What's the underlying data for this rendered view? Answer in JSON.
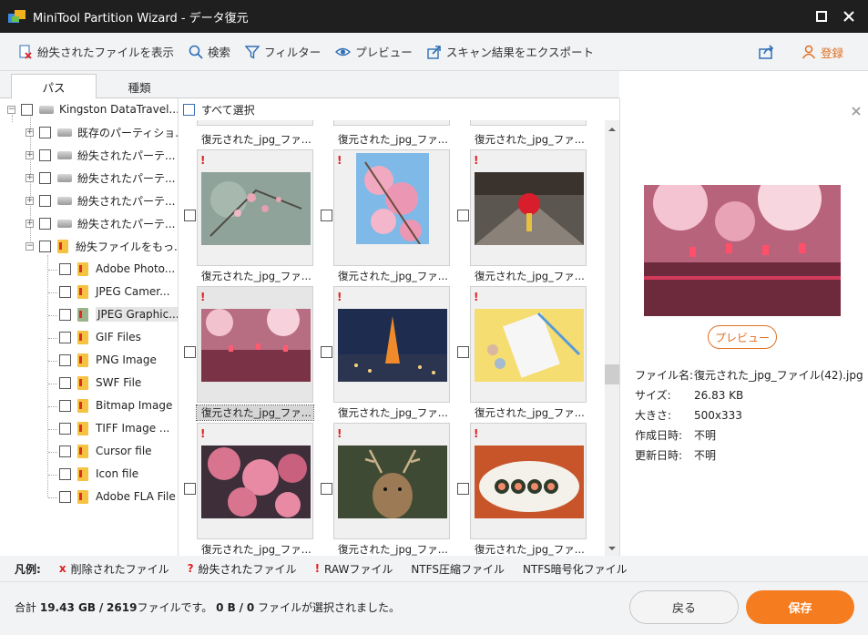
{
  "window": {
    "title": "MiniTool Partition Wizard - データ復元"
  },
  "toolbar": {
    "show_lost": "紛失されたファイルを表示",
    "search": "検索",
    "filter": "フィルター",
    "preview": "プレビュー",
    "export": "スキャン結果をエクスポート",
    "register": "登録"
  },
  "tabs": {
    "path": "パス",
    "type": "種類"
  },
  "tree": {
    "root": "Kingston DataTravel...",
    "partitions": [
      "既存のパーティショ...",
      "紛失されたパーテ...",
      "紛失されたパーテ...",
      "紛失されたパーテ...",
      "紛失されたパーテ..."
    ],
    "lost_files": "紛失ファイルをもっ...",
    "children": [
      "Adobe Photo...",
      "JPEG Camer...",
      "JPEG Graphic...",
      "GIF Files",
      "PNG Image",
      "SWF File",
      "Bitmap Image",
      "TIFF Image ...",
      "Cursor file",
      "Icon file",
      "Adobe FLA File"
    ]
  },
  "grid": {
    "select_all": "すべて選択",
    "caption": "復元された_jpg_ファ...",
    "mark": "!"
  },
  "preview_panel": {
    "button": "プレビュー",
    "filename_label": "ファイル名:",
    "filename": "復元された_jpg_ファイル(42).jpg",
    "size_label": "サイズ:",
    "size": "26.83 KB",
    "dim_label": "大きさ:",
    "dim": "500x333",
    "created_label": "作成日時:",
    "created": "不明",
    "modified_label": "更新日時:",
    "modified": "不明"
  },
  "legend": {
    "label": "凡例:",
    "deleted": "削除されたファイル",
    "lost": "紛失されたファイル",
    "raw": "RAWファイル",
    "compressed": "NTFS圧縮ファイル",
    "encrypted": "NTFS暗号化ファイル",
    "deleted_mark": "x",
    "lost_mark": "?",
    "raw_mark": "!"
  },
  "footer": {
    "total_label": "合計",
    "total_size": "19.43 GB",
    "slash1": "/",
    "file_count": "2619",
    "files_text": "ファイルです。",
    "selected_size": "0 B",
    "slash2": "/",
    "selected_count": "0",
    "selected_text": "ファイルが選択されました。",
    "back": "戻る",
    "save": "保存"
  },
  "colors": {
    "accent": "#f57c1f",
    "titlebar": "#1f1f1f",
    "mark_red": "#e02020"
  }
}
